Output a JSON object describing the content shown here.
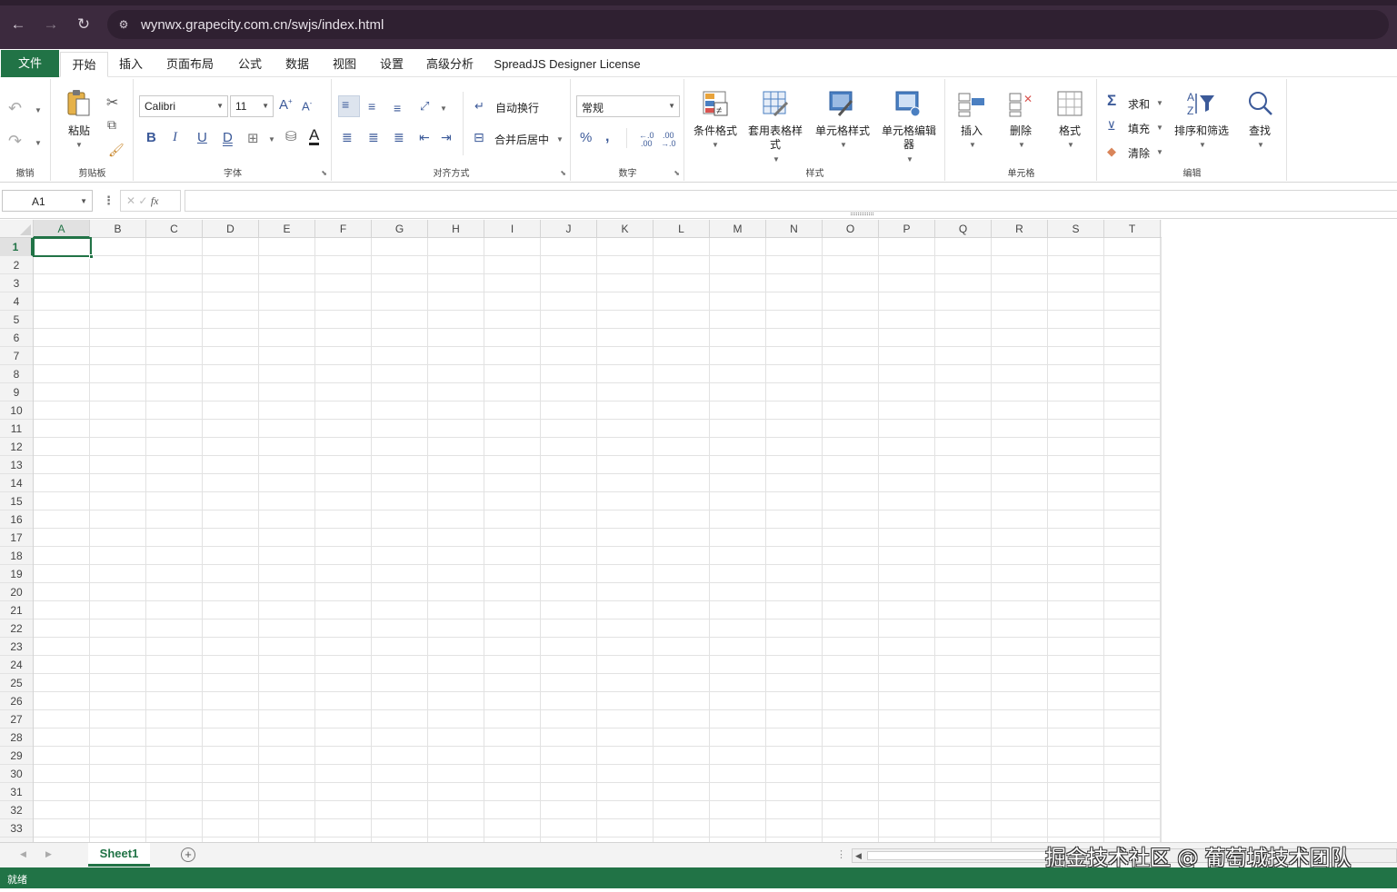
{
  "browser": {
    "url": "wynwx.grapecity.com.cn/swjs/index.html",
    "icons": [
      "back-arrow-icon",
      "forward-arrow-icon",
      "reload-icon",
      "site-settings-icon"
    ]
  },
  "ribbon_tabs": [
    "文件",
    "开始",
    "插入",
    "页面布局",
    "公式",
    "数据",
    "视图",
    "设置",
    "高级分析",
    "SpreadJS Designer License"
  ],
  "active_tab": "开始",
  "ribbon": {
    "undo_group": {
      "label": "撤销"
    },
    "clipboard": {
      "label": "剪贴板",
      "paste": "粘贴"
    },
    "font": {
      "label": "字体",
      "family": "Calibri",
      "size": "11"
    },
    "alignment": {
      "label": "对齐方式",
      "wrap": "自动换行",
      "merge": "合并后居中"
    },
    "number": {
      "label": "数字",
      "format": "常规"
    },
    "styles": {
      "label": "样式",
      "cond_format": "条件格式",
      "table_style": "套用表格样式",
      "cell_style": "单元格样式",
      "cell_editor": "单元格编辑器"
    },
    "cells": {
      "label": "单元格",
      "insert": "插入",
      "delete": "删除",
      "format": "格式"
    },
    "editing": {
      "label": "编辑",
      "sum": "求和",
      "fill": "填充",
      "clear": "清除",
      "sort_filter": "排序和筛选",
      "find": "查找"
    }
  },
  "formula_bar": {
    "name_box": "A1",
    "fx": "fx",
    "formula": ""
  },
  "grid": {
    "columns": [
      "A",
      "B",
      "C",
      "D",
      "E",
      "F",
      "G",
      "H",
      "I",
      "J",
      "K",
      "L",
      "M",
      "N",
      "O",
      "P",
      "Q",
      "R",
      "S",
      "T"
    ],
    "rows": [
      "1",
      "2",
      "3",
      "4",
      "5",
      "6",
      "7",
      "8",
      "9",
      "10",
      "11",
      "12",
      "13",
      "14",
      "15",
      "16",
      "17",
      "18",
      "19",
      "20",
      "21",
      "22",
      "23",
      "24",
      "25",
      "26",
      "27",
      "28",
      "29",
      "30",
      "31",
      "32",
      "33"
    ],
    "active_cell": "A1"
  },
  "sheets": {
    "tabs": [
      "Sheet1"
    ],
    "active": "Sheet1"
  },
  "status": {
    "text": "就绪"
  },
  "watermark": "掘金技术社区 @ 葡萄城技术团队",
  "colors": {
    "accent": "#217346",
    "browser_bar": "#3c2a3e"
  }
}
